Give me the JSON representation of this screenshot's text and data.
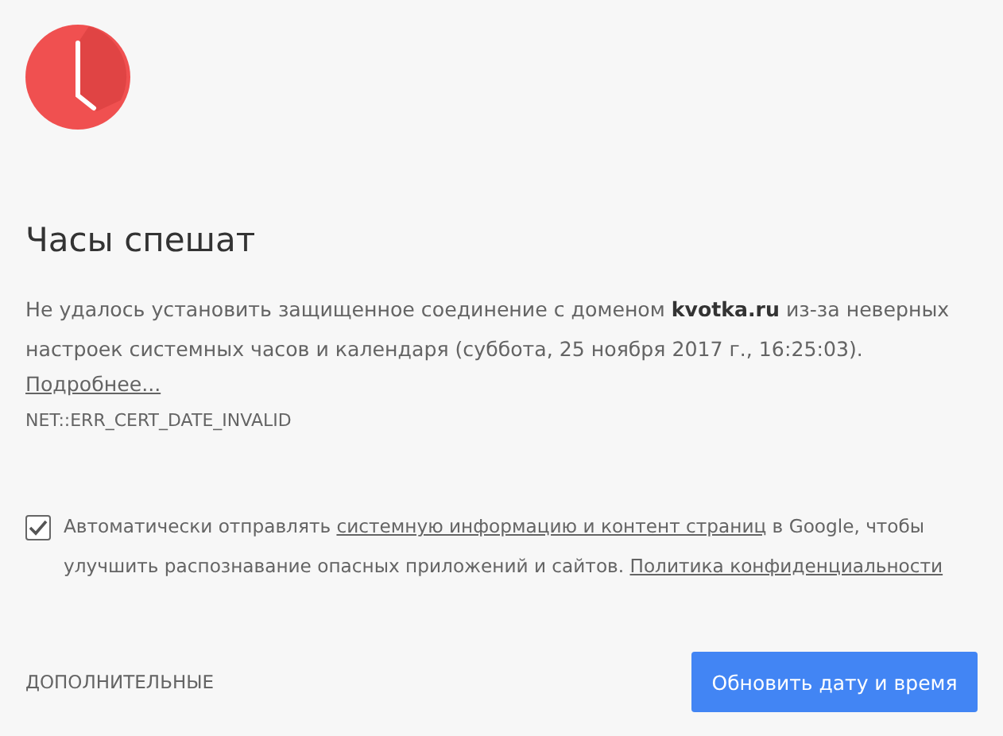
{
  "heading": "Часы спешат",
  "message": "Не удалось установить защищенное соединение с доменом **kvotka.ru** из-за неверных настроек системных часов и календаря (суббота, 25 ноября 2017 г., 16:25:03).",
  "details_link": "Подробнее...",
  "error_code": "NET::ERR_CERT_DATE_INVALID",
  "report": {
    "checked": true,
    "parts": [
      {
        "kind": "text",
        "text": "Автоматически отправлять "
      },
      {
        "kind": "link",
        "text": "системную информацию и контент страниц"
      },
      {
        "kind": "text",
        "text": " в Google, чтобы улучшить распознавание опасных приложений и сайтов. "
      },
      {
        "kind": "link",
        "text": "Политика конфиденциальности"
      }
    ]
  },
  "advanced_button": "ДОПОЛНИТЕЛЬНЫЕ",
  "primary_button": "Обновить дату и время"
}
